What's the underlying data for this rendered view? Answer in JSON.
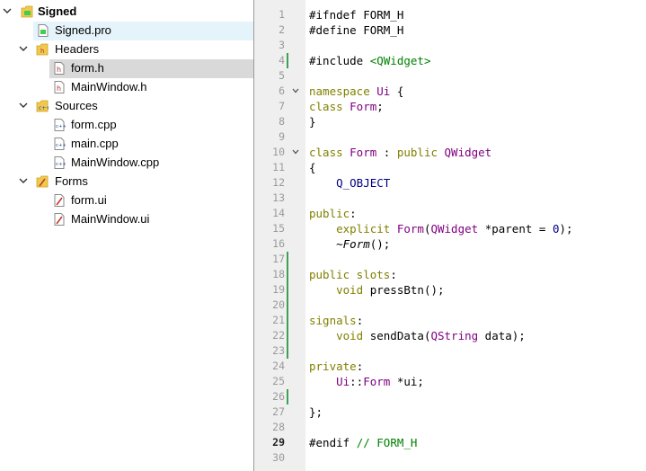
{
  "tree": {
    "root": {
      "label": "Signed"
    },
    "items": [
      {
        "label": "Signed.pro"
      },
      {
        "label": "Headers"
      },
      {
        "label": "form.h"
      },
      {
        "label": "MainWindow.h"
      },
      {
        "label": "Sources"
      },
      {
        "label": "form.cpp"
      },
      {
        "label": "main.cpp"
      },
      {
        "label": "MainWindow.cpp"
      },
      {
        "label": "Forms"
      },
      {
        "label": "form.ui"
      },
      {
        "label": "MainWindow.ui"
      }
    ]
  },
  "editor": {
    "current_line": 29,
    "line_numbers": [
      "1",
      "2",
      "3",
      "4",
      "5",
      "6",
      "7",
      "8",
      "9",
      "10",
      "11",
      "12",
      "13",
      "14",
      "15",
      "16",
      "17",
      "18",
      "19",
      "20",
      "21",
      "22",
      "23",
      "24",
      "25",
      "26",
      "27",
      "28",
      "29",
      "30"
    ],
    "lines": [
      [
        {
          "t": "#ifndef FORM_H",
          "c": ""
        }
      ],
      [
        {
          "t": "#define FORM_H",
          "c": ""
        }
      ],
      [],
      [
        {
          "t": "#include ",
          "c": ""
        },
        {
          "t": "<QWidget>",
          "c": "st"
        }
      ],
      [],
      [
        {
          "t": "namespace ",
          "c": "kw"
        },
        {
          "t": "Ui",
          "c": "ty"
        },
        {
          "t": " {",
          "c": ""
        }
      ],
      [
        {
          "t": "class ",
          "c": "kw"
        },
        {
          "t": "Form",
          "c": "ty"
        },
        {
          "t": ";",
          "c": ""
        }
      ],
      [
        {
          "t": "}",
          "c": ""
        }
      ],
      [],
      [
        {
          "t": "class ",
          "c": "kw"
        },
        {
          "t": "Form",
          "c": "ty"
        },
        {
          "t": " : ",
          "c": ""
        },
        {
          "t": "public ",
          "c": "kw"
        },
        {
          "t": "QWidget",
          "c": "ty"
        }
      ],
      [
        {
          "t": "{",
          "c": ""
        }
      ],
      [
        {
          "t": "    Q_OBJECT",
          "c": "mc"
        }
      ],
      [],
      [
        {
          "t": "public",
          "c": "kw"
        },
        {
          "t": ":",
          "c": ""
        }
      ],
      [
        {
          "t": "    explicit ",
          "c": "kw"
        },
        {
          "t": "Form",
          "c": "ty"
        },
        {
          "t": "(",
          "c": ""
        },
        {
          "t": "QWidget",
          "c": "ty"
        },
        {
          "t": " *parent = ",
          "c": ""
        },
        {
          "t": "0",
          "c": "nm"
        },
        {
          "t": ");",
          "c": ""
        }
      ],
      [
        {
          "t": "    ~",
          "c": ""
        },
        {
          "t": "Form",
          "c": "it"
        },
        {
          "t": "();",
          "c": ""
        }
      ],
      [],
      [
        {
          "t": "public slots",
          "c": "kw"
        },
        {
          "t": ":",
          "c": ""
        }
      ],
      [
        {
          "t": "    void ",
          "c": "kw"
        },
        {
          "t": "pressBtn();",
          "c": ""
        }
      ],
      [],
      [
        {
          "t": "signals",
          "c": "kw"
        },
        {
          "t": ":",
          "c": ""
        }
      ],
      [
        {
          "t": "    void ",
          "c": "kw"
        },
        {
          "t": "sendData(",
          "c": ""
        },
        {
          "t": "QString",
          "c": "ty"
        },
        {
          "t": " data);",
          "c": ""
        }
      ],
      [],
      [
        {
          "t": "private",
          "c": "kw"
        },
        {
          "t": ":",
          "c": ""
        }
      ],
      [
        {
          "t": "    Ui",
          "c": "ty"
        },
        {
          "t": "::",
          "c": ""
        },
        {
          "t": "Form",
          "c": "ty"
        },
        {
          "t": " *ui;",
          "c": ""
        }
      ],
      [],
      [
        {
          "t": "};",
          "c": ""
        }
      ],
      [],
      [
        {
          "t": "#endif ",
          "c": ""
        },
        {
          "t": "// FORM_H",
          "c": "st"
        }
      ],
      []
    ]
  }
}
